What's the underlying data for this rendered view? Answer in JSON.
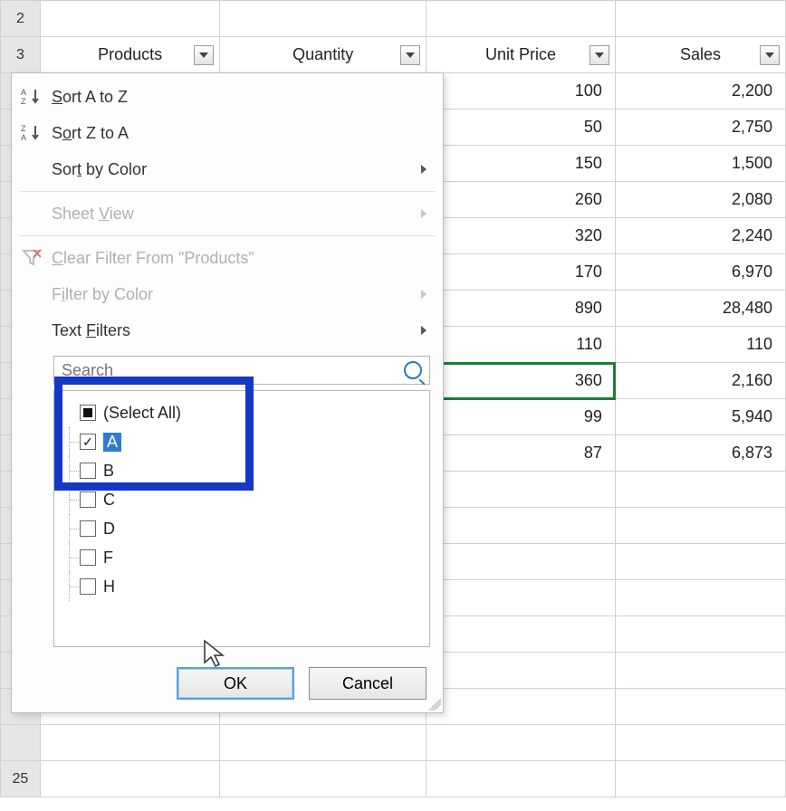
{
  "row_heads": {
    "r2": "2",
    "r3": "3",
    "r25": "25"
  },
  "headers": {
    "products": "Products",
    "quantity": "Quantity",
    "unit_price": "Unit Price",
    "sales": "Sales"
  },
  "rows": [
    {
      "unit_price": "100",
      "sales": "2,200"
    },
    {
      "unit_price": "50",
      "sales": "2,750"
    },
    {
      "unit_price": "150",
      "sales": "1,500"
    },
    {
      "unit_price": "260",
      "sales": "2,080"
    },
    {
      "unit_price": "320",
      "sales": "2,240"
    },
    {
      "unit_price": "170",
      "sales": "6,970"
    },
    {
      "unit_price": "890",
      "sales": "28,480"
    },
    {
      "unit_price": "110",
      "sales": "110"
    },
    {
      "unit_price": "360",
      "sales": "2,160"
    },
    {
      "unit_price": "99",
      "sales": "5,940"
    },
    {
      "unit_price": "87",
      "sales": "6,873"
    }
  ],
  "menu": {
    "sort_az_pre": "S",
    "sort_az_mid": "ort A to Z",
    "sort_za_pre": "S",
    "sort_za_u": "o",
    "sort_za_post": "rt Z to A",
    "sort_color_pre": "Sor",
    "sort_color_u": "t",
    "sort_color_post": " by Color",
    "sheet_view_pre": "Sheet ",
    "sheet_view_u": "V",
    "sheet_view_post": "iew",
    "clear_u": "C",
    "clear_post": "lear Filter From \"Products\"",
    "filter_color_pre": "F",
    "filter_color_u": "i",
    "filter_color_post": "lter by Color",
    "text_filters_pre": "Text ",
    "text_filters_u": "F",
    "text_filters_post": "ilters",
    "search_placeholder": "Search"
  },
  "filter_items": {
    "select_all": "(Select All)",
    "a": "A",
    "b": "B",
    "c": "C",
    "d": "D",
    "f": "F",
    "h": "H"
  },
  "buttons": {
    "ok": "OK",
    "cancel": "Cancel"
  }
}
